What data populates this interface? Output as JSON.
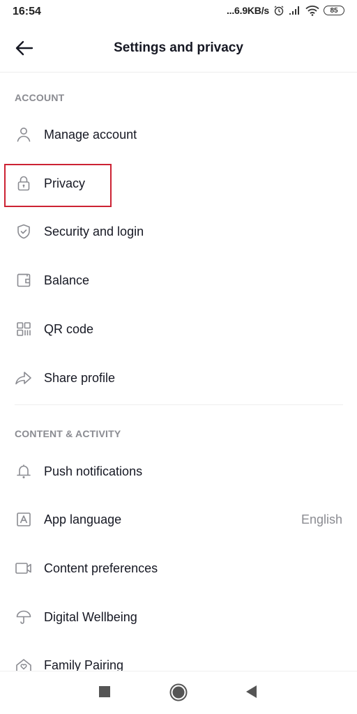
{
  "status_bar": {
    "time": "16:54",
    "net_speed": "...6.9KB/s",
    "icons": [
      "alarm-icon",
      "signal-icon",
      "wifi-icon"
    ],
    "battery": "85"
  },
  "header": {
    "title": "Settings and privacy",
    "back_icon": "arrow-left-icon"
  },
  "sections": [
    {
      "title": "ACCOUNT",
      "items": [
        {
          "label": "Manage account",
          "icon": "person-icon"
        },
        {
          "label": "Privacy",
          "icon": "lock-icon",
          "highlighted": true
        },
        {
          "label": "Security and login",
          "icon": "shield-check-icon"
        },
        {
          "label": "Balance",
          "icon": "wallet-icon"
        },
        {
          "label": "QR code",
          "icon": "qr-code-icon"
        },
        {
          "label": "Share profile",
          "icon": "share-arrow-icon"
        }
      ]
    },
    {
      "title": "CONTENT & ACTIVITY",
      "items": [
        {
          "label": "Push notifications",
          "icon": "bell-icon"
        },
        {
          "label": "App language",
          "icon": "language-icon",
          "value": "English"
        },
        {
          "label": "Content preferences",
          "icon": "video-camera-icon"
        },
        {
          "label": "Digital Wellbeing",
          "icon": "umbrella-icon"
        },
        {
          "label": "Family Pairing",
          "icon": "family-house-icon"
        }
      ]
    }
  ],
  "highlight_color": "#cc2233",
  "system_nav": {
    "buttons": [
      "recents-square-icon",
      "home-circle-icon",
      "back-triangle-icon"
    ]
  }
}
